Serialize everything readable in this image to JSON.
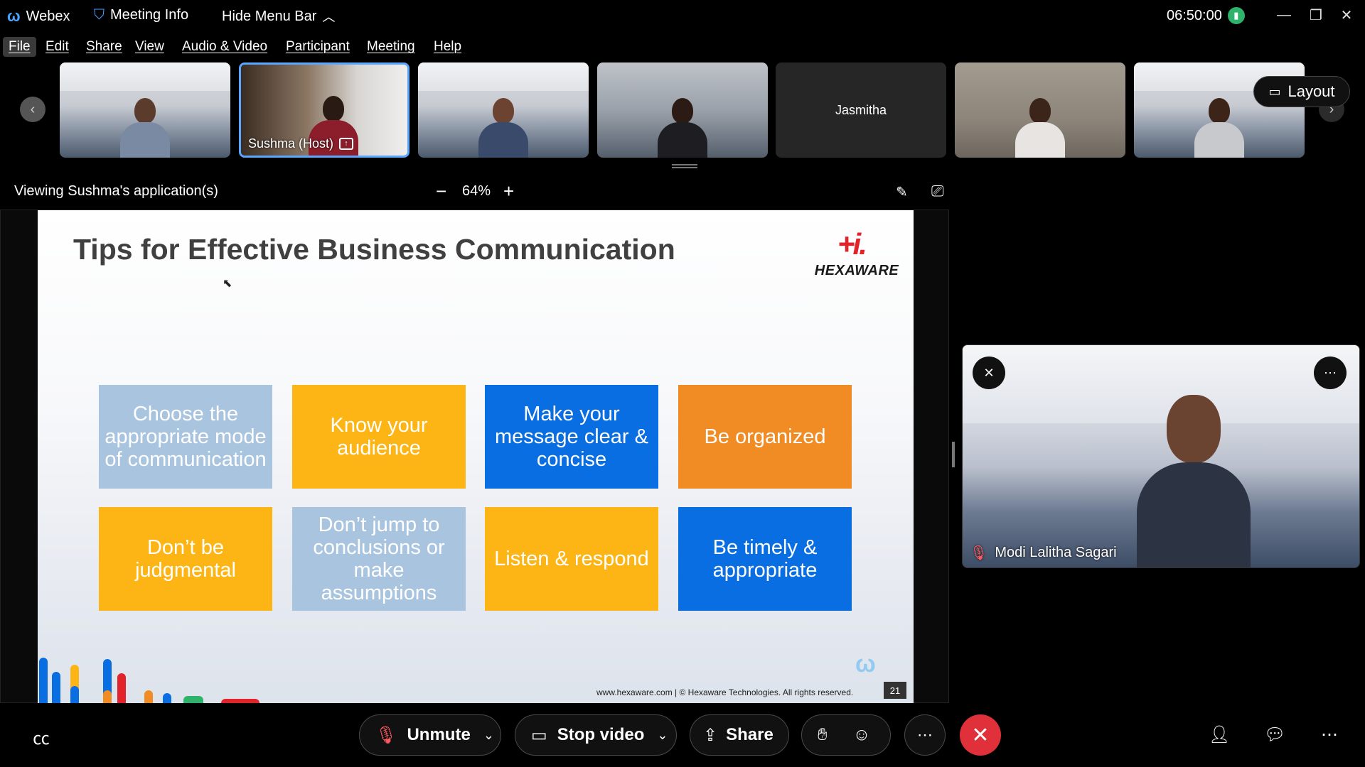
{
  "titlebar": {
    "app_name": "Webex",
    "meeting_info": "Meeting Info",
    "hide_menu_bar": "Hide Menu Bar",
    "clock": "06:50:00"
  },
  "menu": [
    "File",
    "Edit",
    "Share",
    "View",
    "Audio & Video",
    "Participant",
    "Meeting",
    "Help"
  ],
  "filmstrip": {
    "host_name": "Sushma (Host)",
    "no_video_name": "Jasmitha",
    "layout_label": "Layout"
  },
  "viewing": {
    "label": "Viewing Sushma's application(s)",
    "zoom": "64%"
  },
  "slide": {
    "title": "Tips for Effective Business Communication",
    "logo_text": "HEXAWARE",
    "logo_mark": "+i.",
    "cards": [
      {
        "text": "Choose the appropriate mode of communication",
        "color": "#a9c4de"
      },
      {
        "text": "Know your audience",
        "color": "#fdb515"
      },
      {
        "text": "Make your message clear & concise",
        "color": "#0a6ee3"
      },
      {
        "text": "Be organized",
        "color": "#f18b23"
      },
      {
        "text": "Don’t be judgmental",
        "color": "#fdb515"
      },
      {
        "text": "Don’t jump to conclusions or make assumptions",
        "color": "#a9c4de"
      },
      {
        "text": "Listen & respond",
        "color": "#fdb515"
      },
      {
        "text": "Be timely & appropriate",
        "color": "#0a6ee3"
      }
    ],
    "footer": "www.hexaware.com  | © Hexaware Technologies. All rights reserved.",
    "page_number": "21"
  },
  "side_video": {
    "name": "Modi Lalitha Sagari"
  },
  "controls": {
    "unmute": "Unmute",
    "stop_video": "Stop video",
    "share": "Share"
  },
  "colors": {
    "leave_red": "#e0303a",
    "host_border": "#5aa7ff",
    "muted_red": "#ff5a5f"
  }
}
